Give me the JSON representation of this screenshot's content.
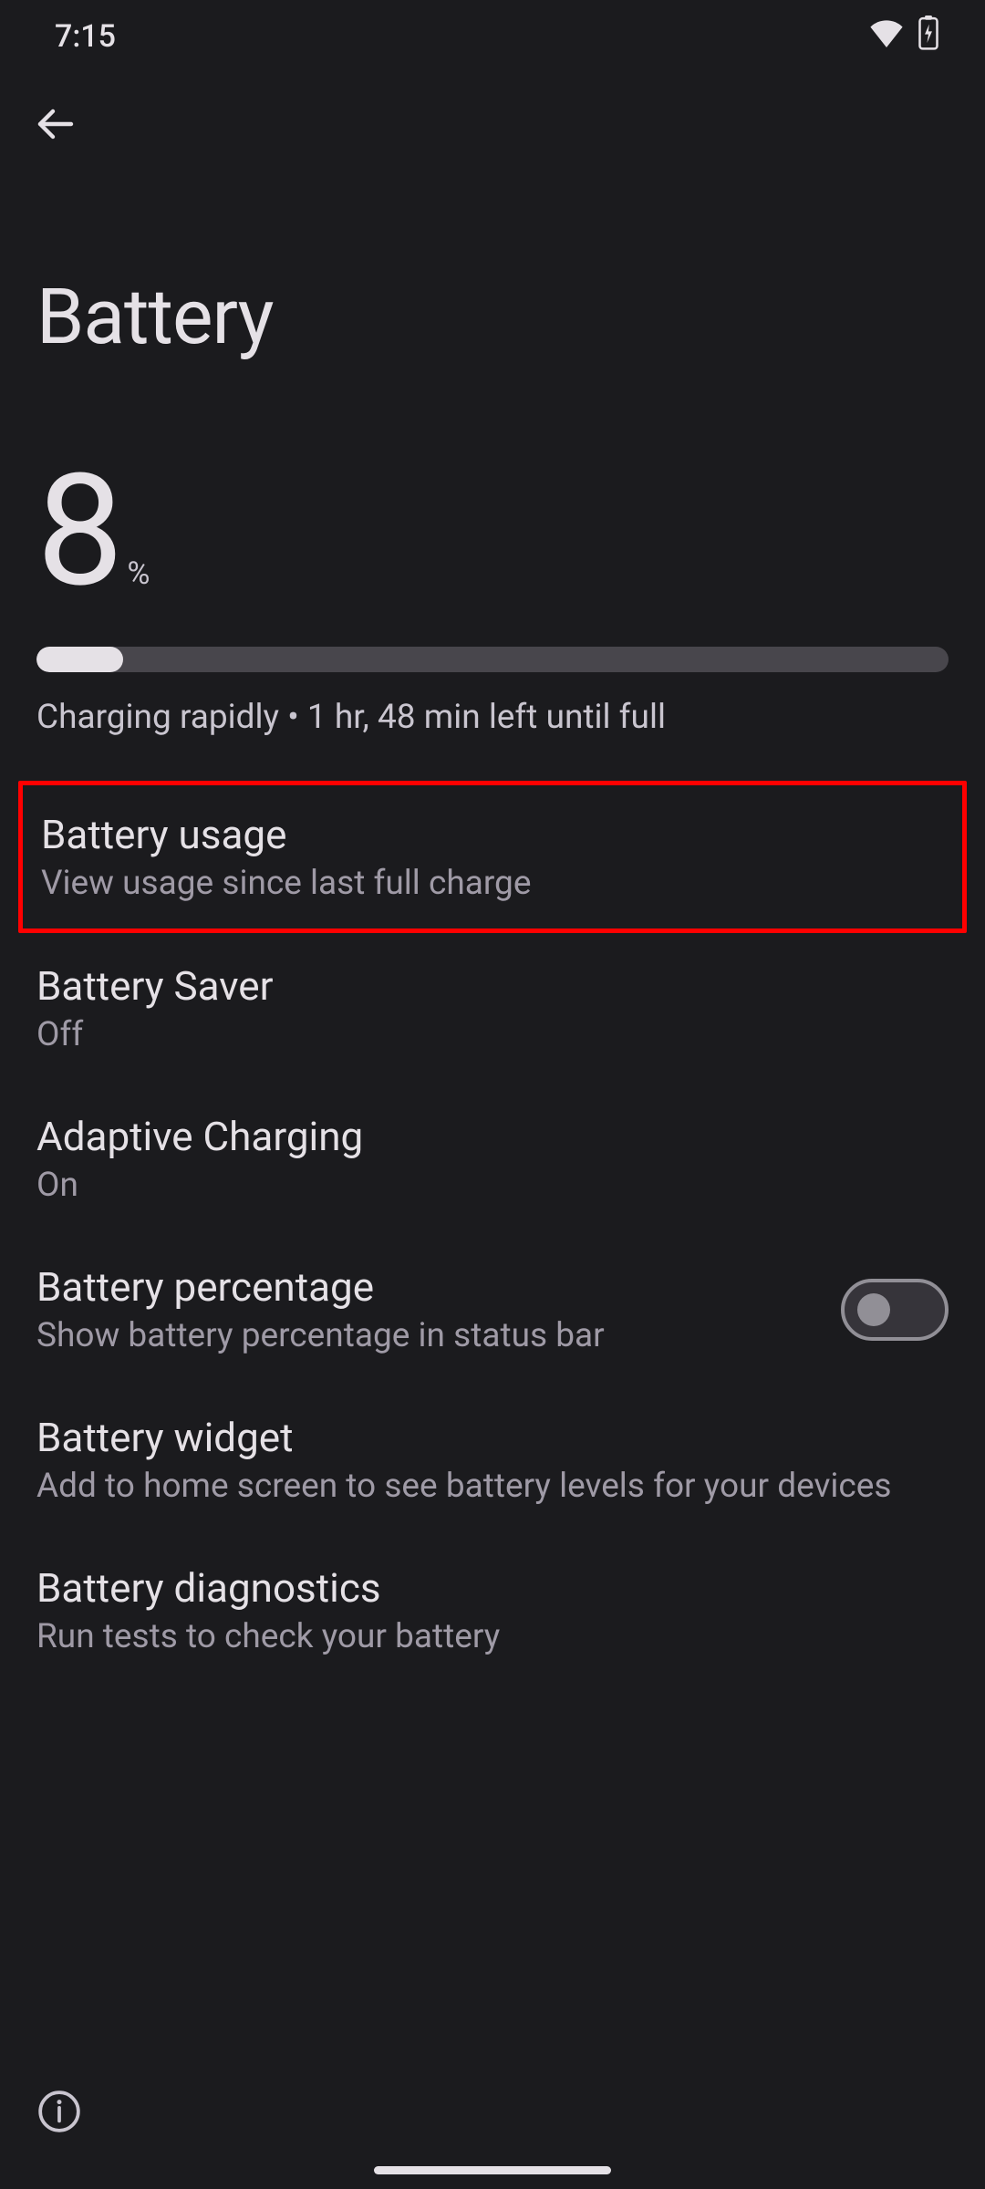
{
  "status_bar": {
    "time": "7:15"
  },
  "page": {
    "title": "Battery",
    "percent_value": "8",
    "percent_symbol": "%",
    "progress_percent": 8,
    "status_line": "Charging rapidly • 1 hr, 48 min left until full"
  },
  "rows": {
    "usage": {
      "title": "Battery usage",
      "sub": "View usage since last full charge"
    },
    "saver": {
      "title": "Battery Saver",
      "sub": "Off"
    },
    "adaptive": {
      "title": "Adaptive Charging",
      "sub": "On"
    },
    "percentage": {
      "title": "Battery percentage",
      "sub": "Show battery percentage in status bar",
      "toggle_on": false
    },
    "widget": {
      "title": "Battery widget",
      "sub": "Add to home screen to see battery levels for your devices"
    },
    "diagnostics": {
      "title": "Battery diagnostics",
      "sub": "Run tests to check your battery"
    }
  },
  "highlight_row": "usage"
}
